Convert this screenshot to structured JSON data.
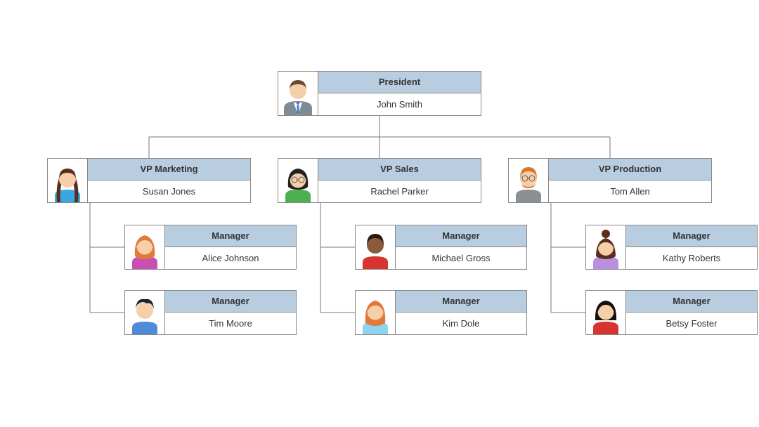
{
  "org": {
    "president": {
      "title": "President",
      "name": "John Smith"
    },
    "vp_marketing": {
      "title": "VP Marketing",
      "name": "Susan Jones"
    },
    "vp_sales": {
      "title": "VP Sales",
      "name": "Rachel Parker"
    },
    "vp_production": {
      "title": "VP Production",
      "name": "Tom Allen"
    },
    "mgr_marketing_1": {
      "title": "Manager",
      "name": "Alice Johnson"
    },
    "mgr_marketing_2": {
      "title": "Manager",
      "name": "Tim Moore"
    },
    "mgr_sales_1": {
      "title": "Manager",
      "name": "Michael Gross"
    },
    "mgr_sales_2": {
      "title": "Manager",
      "name": "Kim Dole"
    },
    "mgr_production_1": {
      "title": "Manager",
      "name": "Kathy Roberts"
    },
    "mgr_production_2": {
      "title": "Manager",
      "name": "Betsy Foster"
    }
  },
  "colors": {
    "header_fill": "#b9cde0"
  }
}
